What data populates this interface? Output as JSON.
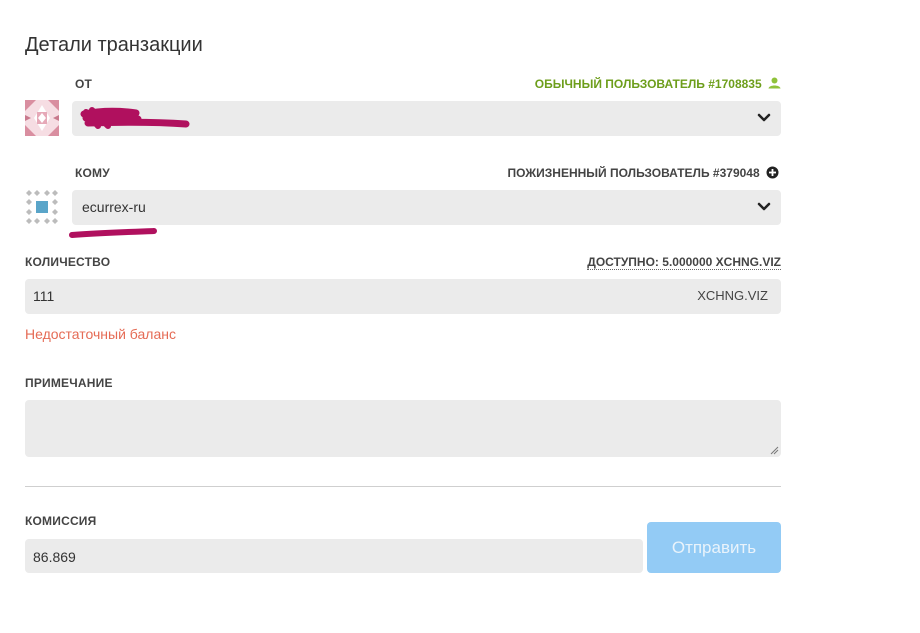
{
  "title": "Детали транзакции",
  "from": {
    "label": "ОТ",
    "account_meta": "ОБЫЧНЫЙ ПОЛЬЗОВАТЕЛЬ #1708835",
    "account_meta_color": "#6d9e1b",
    "selected_value": "",
    "redacted": true
  },
  "to": {
    "label": "КОМУ",
    "account_meta": "ПОЖИЗНЕННЫЙ ПОЛЬЗОВАТЕЛЬ #379048",
    "selected_value": "ecurrex-ru"
  },
  "amount": {
    "label": "КОЛИЧЕСТВО",
    "available": "ДОСТУПНО: 5.000000 XCHNG.VIZ",
    "value": "111",
    "unit": "XCHNG.VIZ",
    "error": "Недостаточный баланс",
    "error_color": "#e56b55"
  },
  "memo": {
    "label": "ПРИМЕЧАНИЕ",
    "value": ""
  },
  "fee": {
    "label": "КОМИССИЯ",
    "value": "86.869"
  },
  "send_button": {
    "label": "Отправить",
    "enabled": false,
    "color": "#93cbf5"
  },
  "icons": {
    "from_meta": "user-icon",
    "to_meta": "plus-circle-icon",
    "select": "chevron-down-icon"
  }
}
